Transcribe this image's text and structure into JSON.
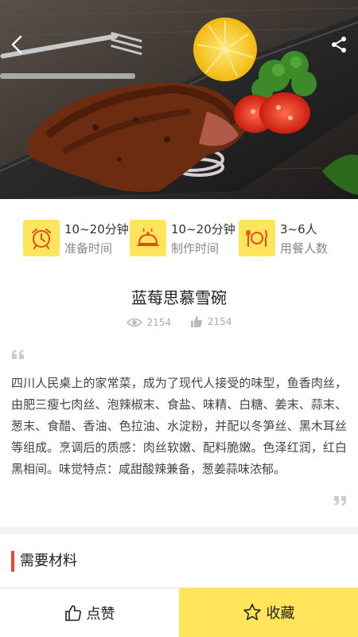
{
  "header": {
    "back_icon": "chevron-left-icon",
    "share_icon": "share-icon",
    "hero_image": "steak-dish-photo"
  },
  "info": [
    {
      "icon": "alarm-clock-icon",
      "value": "10~20分钟",
      "label": "准备时间"
    },
    {
      "icon": "cloche-icon",
      "value": "10~20分钟",
      "label": "制作时间"
    },
    {
      "icon": "plate-cutlery-icon",
      "value": "3~6人",
      "label": "用餐人数"
    }
  ],
  "recipe": {
    "title": "蓝莓思慕雪碗",
    "views": "2154",
    "likes": "2154",
    "description": "四川人民桌上的家常菜，成为了现代人接受的味型，鱼香肉丝，由肥三瘦七肉丝、泡辣椒末、食盐、味精、白糖、姜末、蒜末、葱末、食醋、香油、色拉油、水淀粉，并配以冬笋丝、黑木耳丝等组成。烹调后的质感：肉丝软嫩、配料脆嫩。色泽红润，红白黑相间。味觉特点：咸甜酸辣兼备，葱姜蒜味浓郁。"
  },
  "ingredients": {
    "title": "需要材料"
  },
  "actions": {
    "like_label": "点赞",
    "favorite_label": "收藏"
  },
  "colors": {
    "accent_yellow": "#FFE45C",
    "section_marker_red": "#F44336"
  }
}
